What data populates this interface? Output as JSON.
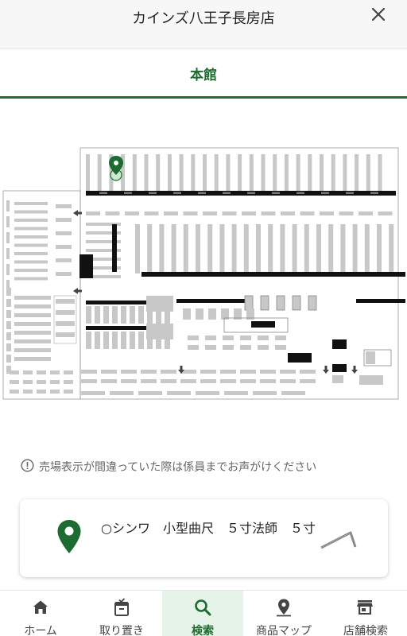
{
  "header": {
    "title": "カインズ八王子長房店",
    "close_icon": "close-icon"
  },
  "tab": {
    "label": "本館"
  },
  "notice": {
    "text": "売場表示が間違っていた際は係員までお声がけください",
    "icon": "info-icon"
  },
  "product": {
    "name": "○シンワ　小型曲尺　５寸法師　５寸",
    "pin_icon": "map-pin-icon"
  },
  "nav": {
    "items": [
      {
        "label": "ホーム",
        "icon": "home-icon"
      },
      {
        "label": "取り置き",
        "icon": "reserve-icon"
      },
      {
        "label": "検索",
        "icon": "search-icon",
        "active": true
      },
      {
        "label": "商品マップ",
        "icon": "map-pin-icon"
      },
      {
        "label": "店舗検索",
        "icon": "store-icon"
      }
    ]
  },
  "colors": {
    "accent": "#1d6b30",
    "active_nav_bg": "#e6f3e8"
  }
}
